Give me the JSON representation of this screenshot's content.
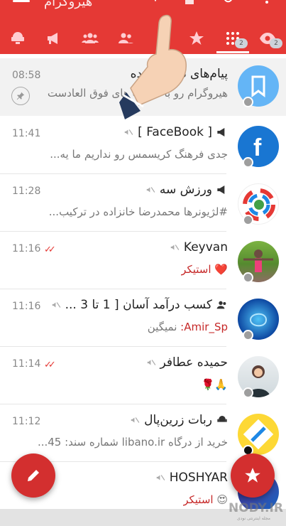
{
  "header": {
    "title": "هیروگرام",
    "icons": [
      "menu-icon",
      "refresh-icon",
      "home-icon",
      "search-icon",
      "more-vert-icon"
    ]
  },
  "tabs": [
    {
      "icon": "eye-icon",
      "badge": "2"
    },
    {
      "icon": "grid-icon",
      "badge": "2"
    },
    {
      "icon": "star-icon"
    },
    {
      "icon": "user-icon"
    },
    {
      "icon": "users-icon"
    },
    {
      "icon": "group-icon"
    },
    {
      "icon": "megaphone-icon"
    },
    {
      "icon": "robot-icon"
    }
  ],
  "chats": [
    {
      "name": "پیام‌های ذخیره شده",
      "preview": "هیروگرام رو با قابلیت های فوق العادست",
      "time": "08:58",
      "pinned": true,
      "avatar": "bookmark-avatar"
    },
    {
      "name": "[ FaceBook ]",
      "preview": "جدی فرهنگ کریسمس رو نداریم ما یه...",
      "time": "11:41",
      "type": "channel",
      "muted": true,
      "avatar": "facebook-avatar"
    },
    {
      "name": "ورزش سه",
      "preview": "#لژیونرها  محمدرضا خانزاده در ترکیب...",
      "time": "11:28",
      "type": "channel",
      "muted": true,
      "avatar": "varzesh3-avatar"
    },
    {
      "name": "Keyvan",
      "preview_emoji": "❤️",
      "preview_red": "استیکر",
      "time": "11:16",
      "read": true,
      "muted": true,
      "avatar": "photo-avatar"
    },
    {
      "name": "کسب درآمد آسان [ 1 تا 3 ...",
      "preview_red": "Amir_Sp:",
      "preview": "نمیگین",
      "time": "11:16",
      "type": "group",
      "muted": true,
      "avatar": "brain-avatar"
    },
    {
      "name": "حمیده عطافر",
      "preview_emoji": "🙏🌹",
      "time": "11:14",
      "read": true,
      "muted": true,
      "avatar": "woman-avatar"
    },
    {
      "name": "ربات زرین‌پال",
      "preview": "خرید از درگاه libano.ir شماره سند: 45...",
      "time": "11:12",
      "type": "bot",
      "muted": true,
      "avatar": "zarinpal-avatar"
    },
    {
      "name": "HOSHYAR",
      "preview_emoji": "😍",
      "preview_red": "استیکر",
      "time": "",
      "muted": true,
      "avatar": "blue-avatar"
    }
  ],
  "fab": {
    "compose": "pencil-icon",
    "favorites": "star-icon"
  },
  "watermark": {
    "text": "NODY.IR",
    "sub": "مجله اینترنتی نودی"
  },
  "colors": {
    "primary": "#e53935",
    "fab": "#d32f2f",
    "read_ticks": "#e53935"
  }
}
